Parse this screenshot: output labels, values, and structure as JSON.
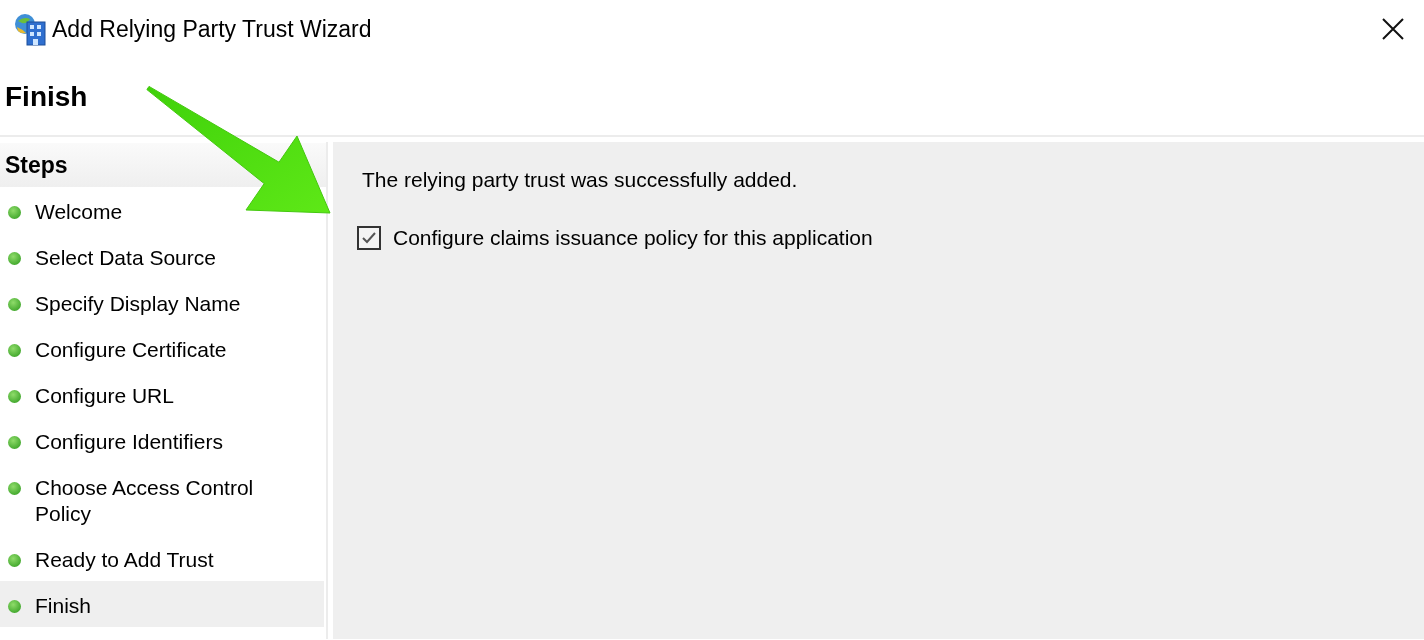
{
  "window": {
    "title": "Add Relying Party Trust Wizard"
  },
  "page": {
    "heading": "Finish"
  },
  "steps": {
    "title": "Steps",
    "items": [
      {
        "label": "Welcome",
        "selected": false
      },
      {
        "label": "Select Data Source",
        "selected": false
      },
      {
        "label": "Specify Display Name",
        "selected": false
      },
      {
        "label": "Configure Certificate",
        "selected": false
      },
      {
        "label": "Configure URL",
        "selected": false
      },
      {
        "label": "Configure Identifiers",
        "selected": false
      },
      {
        "label": "Choose Access Control Policy",
        "selected": false
      },
      {
        "label": "Ready to Add Trust",
        "selected": false
      },
      {
        "label": "Finish",
        "selected": true
      }
    ]
  },
  "content": {
    "message": "The relying party trust was successfully added.",
    "checkbox": {
      "label": "Configure claims issuance policy for this application",
      "checked": true
    }
  }
}
